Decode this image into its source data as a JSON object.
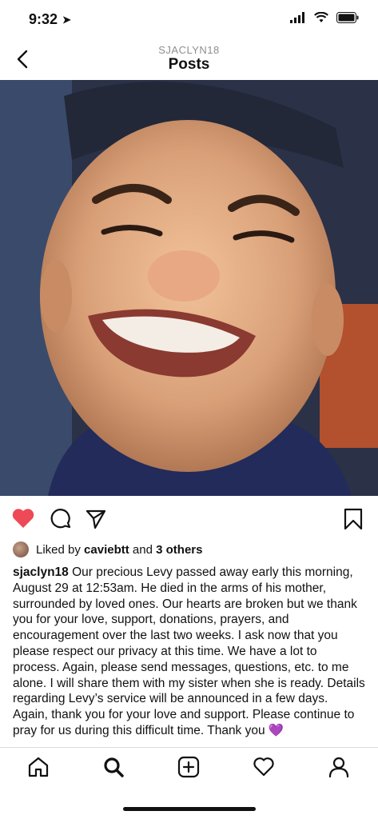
{
  "status": {
    "time": "9:32"
  },
  "header": {
    "username": "SJACLYN18",
    "title": "Posts"
  },
  "post": {
    "liked_by_prefix": "Liked by",
    "liked_by_user": "caviebtt",
    "liked_by_and": "and",
    "liked_by_others": "3 others",
    "caption_user": "sjaclyn18",
    "caption_text": "Our precious Levy passed away early this morning, August 29 at 12:53am. He died in the arms of his mother, surrounded by loved ones. Our hearts are broken but we thank you for your love, support, donations, prayers, and encouragement over the last two weeks. I ask now that you please respect our privacy at this time. We have a lot to process. Again, please send messages, questions, etc. to me alone. I will share them with my sister when she is ready. Details regarding Levy’s service will be announced in a few days. Again, thank you for your love and support. Please continue to pray for us during this difficult time. Thank you",
    "caption_emoji": "💜"
  },
  "colors": {
    "like": "#ed4956",
    "accent_text": "#111111",
    "muted": "#8e8e8e"
  },
  "icons": [
    "location-arrow-icon",
    "signal-icon",
    "wifi-icon",
    "battery-icon",
    "back-chevron-icon",
    "heart-filled-icon",
    "comment-icon",
    "share-icon",
    "bookmark-icon",
    "home-icon",
    "search-icon",
    "add-icon",
    "activity-heart-icon",
    "profile-icon"
  ]
}
